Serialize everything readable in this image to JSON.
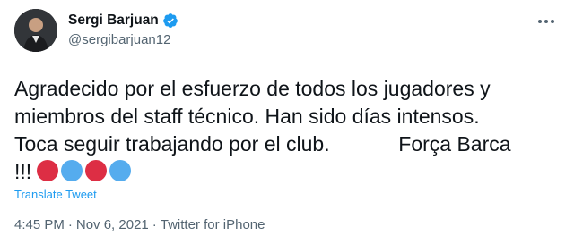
{
  "author": {
    "name": "Sergi Barjuan",
    "handle": "@sergibarjuan12",
    "verified": true
  },
  "tweet": {
    "text": "Agradecido por el esfuerzo de todos los jugadores y\nmiembros del staff técnico. Han sido días intensos.\nToca seguir trabajando por el club.            Força Barca\n!!!",
    "emojis": [
      {
        "name": "red-circle",
        "color": "#dd2e44"
      },
      {
        "name": "blue-circle",
        "color": "#55acee"
      },
      {
        "name": "red-circle",
        "color": "#dd2e44"
      },
      {
        "name": "blue-circle",
        "color": "#55acee"
      }
    ],
    "translate_label": "Translate Tweet"
  },
  "meta": {
    "time": "4:45 PM",
    "separator1": "·",
    "date": "Nov 6, 2021",
    "separator2": "·",
    "source": "Twitter for iPhone"
  },
  "colors": {
    "accent": "#1d9bf0",
    "secondary_text": "#536471",
    "primary_text": "#0f1419"
  },
  "icons": [
    "avatar",
    "verified-badge-icon",
    "more-options-icon"
  ]
}
